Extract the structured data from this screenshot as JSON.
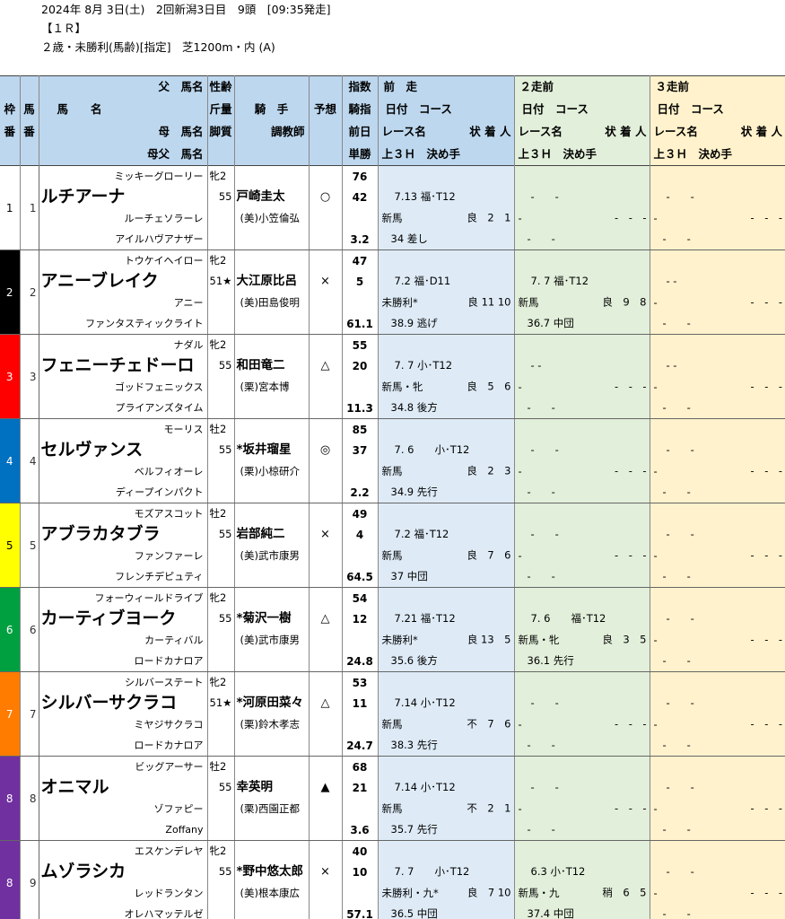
{
  "header": {
    "line1": "2024年 8月 3日(土)　2回新潟3日目　9頭　[09:35発走]",
    "line2": "【１Ｒ】",
    "line3": "２歳・未勝利(馬齢)[指定]　芝1200m・内 (A)"
  },
  "columns": {
    "waku": [
      "枠",
      "番"
    ],
    "uma": [
      "馬",
      "番"
    ],
    "name": [
      "父　馬名",
      "馬　　名",
      "母　馬名",
      "母父　馬名"
    ],
    "sex": [
      "性齢",
      "斤量",
      "脚質"
    ],
    "jockey": [
      "騎　手",
      "調教師"
    ],
    "pred": "予想",
    "index": [
      "指数",
      "騎指",
      "前日",
      "単勝"
    ],
    "z1": [
      "前　走",
      "日付　コース",
      "レース名",
      "状 着 人",
      "上３Ｈ　決め手"
    ],
    "z2": [
      "２走前",
      "日付　コース",
      "レース名",
      "状 着 人",
      "上３Ｈ　決め手"
    ],
    "z3": [
      "３走前",
      "日付　コース",
      "レース名",
      "状 着 人",
      "上３Ｈ　決め手"
    ]
  },
  "waku_colors": [
    "#ffffff",
    "#000000",
    "#ff0000",
    "#0070c0",
    "#ffff00",
    "#00a040",
    "#ff7c00",
    "#7030a0",
    "#7030a0"
  ],
  "horses": [
    {
      "waku": "1",
      "uma": "1",
      "sire": "ミッキーグローリー",
      "name": "ルチアーナ",
      "dam": "ルーチェソラーレ",
      "damsire": "アイルハヴアナザー",
      "sex": "牝2",
      "weight": "55",
      "jockey": "戸崎圭太",
      "trainer": "(美)小笠倫弘",
      "pred": "○",
      "idx": "76",
      "kishi": "42",
      "odds": "3.2",
      "z1": {
        "date": "7.13 福･T12",
        "race": "新馬",
        "res": "良　2　1",
        "last": "34 差し"
      },
      "z2": {
        "date": "-　　-",
        "race": "-",
        "res": "-　-　-",
        "last": "-　　-"
      },
      "z3": {
        "date": "-　　-",
        "race": "-",
        "res": "-　-　-",
        "last": "-　　-"
      }
    },
    {
      "waku": "2",
      "uma": "2",
      "sire": "トウケイヘイロー",
      "name": "アニーブレイク",
      "dam": "アニー",
      "damsire": "ファンタスティックライト",
      "sex": "牝2",
      "weight": "51★",
      "jockey": "大江原比呂",
      "trainer": "(美)田島俊明",
      "pred": "×",
      "idx": "47",
      "kishi": "5",
      "odds": "61.1",
      "z1": {
        "date": "7.2 福･D11",
        "race": "未勝利*",
        "res": "良 11 10",
        "last": "38.9 逃げ"
      },
      "z2": {
        "date": "7. 7 福･T12",
        "race": "新馬",
        "res": "良　9　8",
        "last": "36.7 中団"
      },
      "z3": {
        "date": "- -",
        "race": "-",
        "res": "-　-　-",
        "last": "-　　-"
      }
    },
    {
      "waku": "3",
      "uma": "3",
      "sire": "ナダル",
      "name": "フェニーチェドーロ",
      "dam": "ゴッドフェニックス",
      "damsire": "プライアンズタイム",
      "sex": "牝2",
      "weight": "55",
      "jockey": "和田竜二",
      "trainer": "(栗)宮本博",
      "pred": "△",
      "idx": "55",
      "kishi": "20",
      "odds": "11.3",
      "z1": {
        "date": "7. 7 小･T12",
        "race": "新馬・牝",
        "res": "良　5　6",
        "last": "34.8 後方"
      },
      "z2": {
        "date": "- -",
        "race": "-",
        "res": "-　-　-",
        "last": "-　　-"
      },
      "z3": {
        "date": "- -",
        "race": "-",
        "res": "-　-　-",
        "last": "-　　-"
      }
    },
    {
      "waku": "4",
      "uma": "4",
      "sire": "モーリス",
      "name": "セルヴァンス",
      "dam": "ベルフィオーレ",
      "damsire": "ディープインパクト",
      "sex": "牡2",
      "weight": "55",
      "jockey": "*坂井瑠星",
      "trainer": "(栗)小椋研介",
      "pred": "◎",
      "idx": "85",
      "kishi": "37",
      "odds": "2.2",
      "z1": {
        "date": "7. 6　　小･T12",
        "race": "新馬",
        "res": "良　2　3",
        "last": "34.9 先行"
      },
      "z2": {
        "date": "-　　-",
        "race": "-",
        "res": "-　-　-",
        "last": "-　　-"
      },
      "z3": {
        "date": "-　　-",
        "race": "-",
        "res": "-　-　-",
        "last": "-　　-"
      }
    },
    {
      "waku": "5",
      "uma": "5",
      "sire": "モズアスコット",
      "name": "アブラカタブラ",
      "dam": "ファンファーレ",
      "damsire": "フレンチデピュティ",
      "sex": "牡2",
      "weight": "55",
      "jockey": "岩部純二",
      "trainer": "(美)武市康男",
      "pred": "×",
      "idx": "49",
      "kishi": "4",
      "odds": "64.5",
      "z1": {
        "date": "7.2 福･T12",
        "race": "新馬",
        "res": "良　7　6",
        "last": "37 中団"
      },
      "z2": {
        "date": "-　　-",
        "race": "-",
        "res": "-　-　-",
        "last": "-　　-"
      },
      "z3": {
        "date": "-　　-",
        "race": "-",
        "res": "-　-　-",
        "last": "-　　-"
      }
    },
    {
      "waku": "6",
      "uma": "6",
      "sire": "フォーウィールドライブ",
      "name": "カーティブヨーク",
      "dam": "カーティバル",
      "damsire": "ロードカナロア",
      "sex": "牝2",
      "weight": "55",
      "jockey": "*菊沢一樹",
      "trainer": "(美)武市康男",
      "pred": "△",
      "idx": "54",
      "kishi": "12",
      "odds": "24.8",
      "z1": {
        "date": "7.21 福･T12",
        "race": "未勝利*",
        "res": "良 13　5",
        "last": "35.6 後方"
      },
      "z2": {
        "date": "7. 6　　福･T12",
        "race": "新馬・牝",
        "res": "良　3　5",
        "last": "36.1 先行"
      },
      "z3": {
        "date": "-　　-",
        "race": "-",
        "res": "-　-　-",
        "last": "-　　-"
      }
    },
    {
      "waku": "7",
      "uma": "7",
      "sire": "シルバーステート",
      "name": "シルバーサクラコ",
      "dam": "ミヤジサクラコ",
      "damsire": "ロードカナロア",
      "sex": "牝2",
      "weight": "51★",
      "jockey": "*河原田菜々",
      "trainer": "(栗)鈴木孝志",
      "pred": "△",
      "idx": "53",
      "kishi": "11",
      "odds": "24.7",
      "z1": {
        "date": "7.14 小･T12",
        "race": "新馬",
        "res": "不　7　6",
        "last": "38.3 先行"
      },
      "z2": {
        "date": "-　　-",
        "race": "-",
        "res": "-　-　-",
        "last": "-　　-"
      },
      "z3": {
        "date": "-　　-",
        "race": "-",
        "res": "-　-　-",
        "last": "-　　-"
      }
    },
    {
      "waku": "8",
      "uma": "8",
      "sire": "ビッグアーサー",
      "name": "オニマル",
      "dam": "ゾファピー",
      "damsire": "Zoffany",
      "sex": "牡2",
      "weight": "55",
      "jockey": "幸英明",
      "trainer": "(栗)西園正都",
      "pred": "▲",
      "idx": "68",
      "kishi": "21",
      "odds": "3.6",
      "z1": {
        "date": "7.14 小･T12",
        "race": "新馬",
        "res": "不　2　1",
        "last": "35.7 先行"
      },
      "z2": {
        "date": "-　　-",
        "race": "-",
        "res": "-　-　-",
        "last": "-　　-"
      },
      "z3": {
        "date": "-　　-",
        "race": "-",
        "res": "-　-　-",
        "last": "-　　-"
      }
    },
    {
      "waku": "8",
      "uma": "9",
      "sire": "エスケンデレヤ",
      "name": "ムゾラシカ",
      "dam": "レッドランタン",
      "damsire": "オレハマッテルゼ",
      "sex": "牝2",
      "weight": "55",
      "jockey": "*野中悠太郎",
      "trainer": "(美)根本康広",
      "pred": "×",
      "idx": "40",
      "kishi": "10",
      "odds": "57.1",
      "z1": {
        "date": "7. 7　　小･T12",
        "race": "未勝利・九*",
        "res": "良　7 10",
        "last": "36.5 中団"
      },
      "z2": {
        "date": "6.3 小･T12",
        "race": "新馬・九",
        "res": "稍　6　5",
        "last": "37.4 中団"
      },
      "z3": {
        "date": "-　　-",
        "race": "-",
        "res": "-　-　-",
        "last": "-　　-"
      }
    }
  ]
}
